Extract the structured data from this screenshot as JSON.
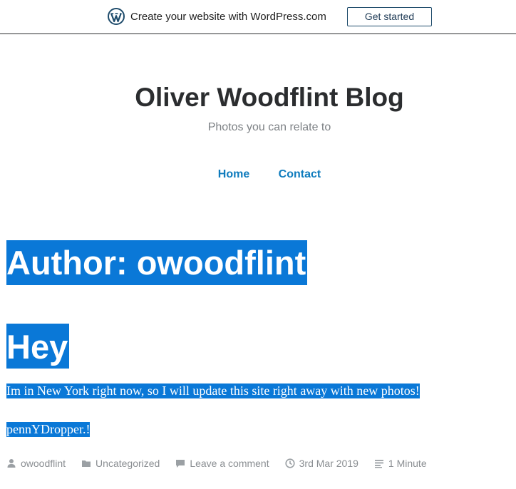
{
  "banner": {
    "logo_icon": "wordpress-logo-icon",
    "promo_text": "Create your website with WordPress.com",
    "cta_label": "Get started"
  },
  "site": {
    "title": "Oliver Woodflint Blog",
    "tagline": "Photos you can relate to"
  },
  "nav": {
    "items": [
      {
        "label": "Home"
      },
      {
        "label": "Contact"
      }
    ]
  },
  "archive": {
    "title": "Author: owoodflint"
  },
  "post": {
    "title": "Hey",
    "paragraphs": [
      "Im in New York right now, so I will update this site right away with new photos!",
      "pennYDropper.!"
    ],
    "meta": {
      "author": "owoodflint",
      "category": "Uncategorized",
      "comments": "Leave a comment",
      "date": "3rd Mar 2019",
      "reading_time": "1 Minute"
    }
  },
  "colors": {
    "link": "#0e7bbd",
    "selection": "#0a78d7",
    "meta": "#8a8e92"
  }
}
